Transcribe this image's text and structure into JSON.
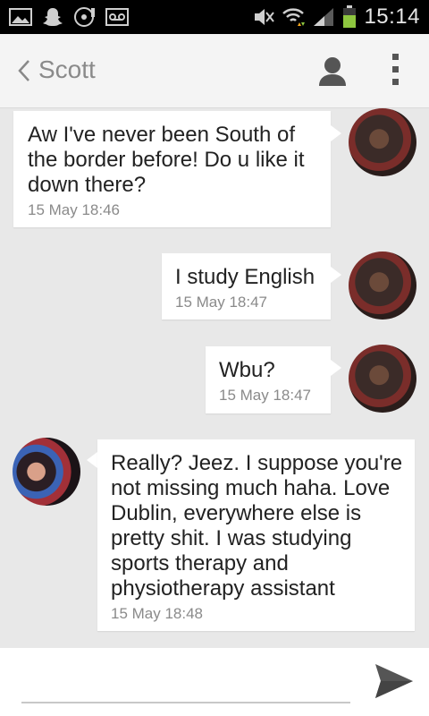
{
  "status_bar": {
    "time": "15:14",
    "icons": [
      "gallery-icon",
      "snapchat-icon",
      "music-icon",
      "voicemail-icon",
      "mute-icon",
      "wifi-icon",
      "signal-icon",
      "battery-icon"
    ]
  },
  "header": {
    "contact_name": "Scott",
    "back_icon": "chevron-left-icon",
    "profile_icon": "person-icon",
    "menu_icon": "overflow-menu-icon"
  },
  "messages": [
    {
      "sender": "me",
      "lines": [
        "Aw I've never been South of",
        "the border before! Do u like it",
        "down there?"
      ],
      "time": "15 May  18:46"
    },
    {
      "sender": "me",
      "lines": [
        "I study English"
      ],
      "time": "15 May  18:47"
    },
    {
      "sender": "me",
      "lines": [
        "Wbu?"
      ],
      "time": "15 May  18:47"
    },
    {
      "sender": "Scott",
      "lines": [
        "Really? Jeez. I suppose you're",
        "not missing much haha. Love",
        "Dublin, everywhere else is",
        "pretty shit. I was studying",
        "sports therapy and",
        "physiotherapy assistant"
      ],
      "time": "15 May  18:48"
    }
  ],
  "composer": {
    "placeholder": "",
    "send_icon": "send-icon"
  },
  "colors": {
    "background": "#e8e8e8",
    "bubble": "#ffffff",
    "status_bar": "#000000",
    "battery": "#8ec63f"
  }
}
